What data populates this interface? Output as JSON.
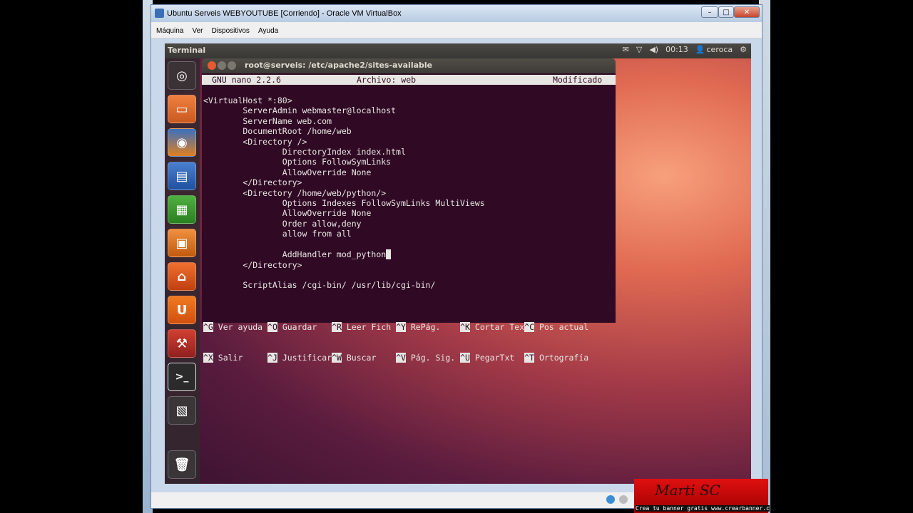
{
  "vbox": {
    "title": "Ubuntu Serveis WEBYOUTUBE [Corriendo] - Oracle VM VirtualBox",
    "menu": [
      "Máquina",
      "Ver",
      "Dispositivos",
      "Ayuda"
    ],
    "minimize": "–",
    "maximize": "□",
    "close": "✕"
  },
  "panel": {
    "app_title": "Terminal",
    "time": "00:13",
    "user": "ceroca"
  },
  "launcher": {
    "items": [
      "dash-home",
      "files",
      "firefox",
      "writer",
      "calc",
      "impress",
      "software-center",
      "ubuntu-one",
      "system-settings",
      "terminal",
      "workspaces",
      "trash"
    ]
  },
  "terminal": {
    "title": "root@serveis: /etc/apache2/sites-available",
    "nano_version": "GNU nano 2.2.6",
    "file": "Archivo: web",
    "status": "Modificado",
    "lines": [
      "<VirtualHost *:80>",
      "        ServerAdmin webmaster@localhost",
      "        ServerName web.com",
      "        DocumentRoot /home/web",
      "        <Directory />",
      "                DirectoryIndex index.html",
      "                Options FollowSymLinks",
      "                AllowOverride None",
      "        </Directory>",
      "        <Directory /home/web/python/>",
      "                Options Indexes FollowSymLinks MultiViews",
      "                AllowOverride None",
      "                Order allow,deny",
      "                allow from all",
      "",
      "                AddHandler mod_python",
      "        </Directory>",
      "",
      "        ScriptAlias /cgi-bin/ /usr/lib/cgi-bin/"
    ],
    "shortcuts_row1": [
      {
        "key": "^G",
        "label": " Ver ayuda "
      },
      {
        "key": "^O",
        "label": " Guardar   "
      },
      {
        "key": "^R",
        "label": " Leer Fich "
      },
      {
        "key": "^Y",
        "label": " RePág.    "
      },
      {
        "key": "^K",
        "label": " Cortar Tex"
      },
      {
        "key": "^C",
        "label": " Pos actual"
      }
    ],
    "shortcuts_row2": [
      {
        "key": "^X",
        "label": " Salir     "
      },
      {
        "key": "^J",
        "label": " Justificar"
      },
      {
        "key": "^W",
        "label": " Buscar    "
      },
      {
        "key": "^V",
        "label": " Pág. Sig. "
      },
      {
        "key": "^U",
        "label": " PegarTxt  "
      },
      {
        "key": "^T",
        "label": " Ortografía"
      }
    ]
  },
  "banner": {
    "signature": "Marti SC",
    "caption": "Crea tu banner gratis www.crearbanner.c"
  }
}
